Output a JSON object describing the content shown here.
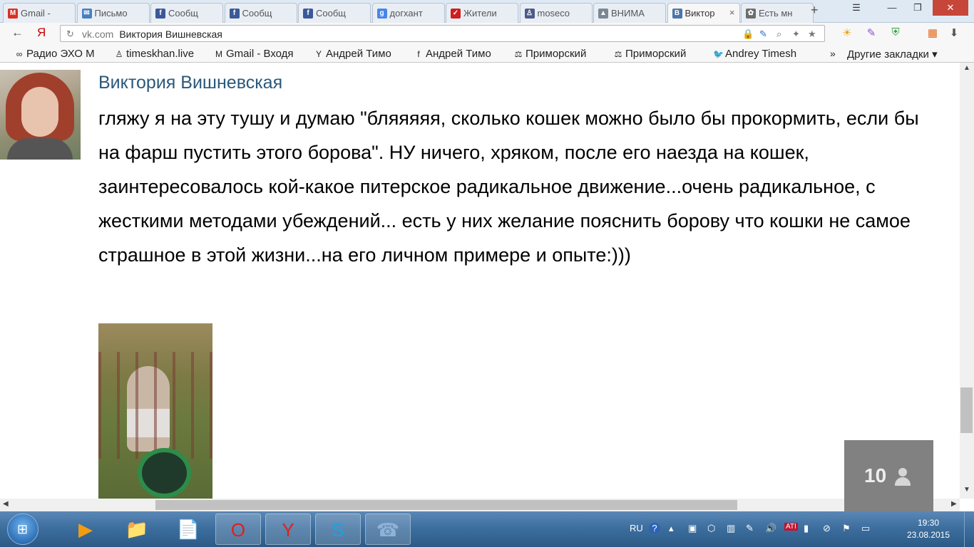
{
  "browser": {
    "tabs": [
      {
        "label": "Gmail -",
        "icon": "gmail-icon",
        "color": "#d93025",
        "glyph": "M"
      },
      {
        "label": "Письмо",
        "icon": "mail-icon",
        "color": "#4a7fbf",
        "glyph": "✉"
      },
      {
        "label": "Сообщ",
        "icon": "facebook-icon",
        "color": "#3b5998",
        "glyph": "f"
      },
      {
        "label": "Сообщ",
        "icon": "facebook-icon",
        "color": "#3b5998",
        "glyph": "f"
      },
      {
        "label": "Сообщ",
        "icon": "facebook-icon",
        "color": "#3b5998",
        "glyph": "f"
      },
      {
        "label": "догхант",
        "icon": "google-plus-icon",
        "color": "#4a86e8",
        "glyph": "g"
      },
      {
        "label": "Жители",
        "icon": "check-icon",
        "color": "#cc1f1f",
        "glyph": "✓"
      },
      {
        "label": "moseco",
        "icon": "user-icon",
        "color": "#4b5b8a",
        "glyph": "♙"
      },
      {
        "label": "ВНИМА",
        "icon": "page-icon",
        "color": "#7b8794",
        "glyph": "▲"
      },
      {
        "label": "Виктор",
        "icon": "vk-icon",
        "color": "#4a76a8",
        "glyph": "B",
        "active": true
      },
      {
        "label": "Есть мн",
        "icon": "paw-icon",
        "color": "#6d6d6d",
        "glyph": "✿"
      }
    ],
    "tab_close": "×",
    "new_tab": "+",
    "window_buttons": {
      "menu": "☰",
      "minimize": "—",
      "maximize": "❐",
      "close": "✕"
    },
    "nav": {
      "back": "←",
      "yandex": "Я"
    },
    "address": {
      "reload": "↻",
      "host": "vk.com",
      "title": "Виктория Вишневская"
    },
    "address_icons": [
      "🔒",
      "✎",
      "⌕",
      "✦",
      "★"
    ],
    "extensions": [
      "☀",
      "✎",
      "⛨",
      "▦",
      "⬇",
      "≡"
    ],
    "bookmarks": [
      {
        "label": "Радио ЭХО М",
        "glyph": "∞"
      },
      {
        "label": "timeskhan.live",
        "glyph": "♙"
      },
      {
        "label": "Gmail - Входя",
        "glyph": "M"
      },
      {
        "label": "Андрей Тимо",
        "glyph": "Y"
      },
      {
        "label": "Андрей Тимо",
        "glyph": "f"
      },
      {
        "label": "Приморский",
        "glyph": "⚖"
      },
      {
        "label": "Приморский",
        "glyph": "⚖"
      },
      {
        "label": "Andrey Timesh",
        "glyph": "🐦"
      }
    ],
    "bookmarks_more": "»",
    "other_bookmarks": "Другие закладки ▾"
  },
  "post": {
    "author": "Виктория Вишневская",
    "text": "гляжу я на эту тушу и думаю \"бляяяяя, сколько кошек можно было бы прокормить, если бы на фарш пустить этого борова\". НУ ничего, хряком, после его наезда на кошек, заинтересовалось кой-какое питерское радикальное движение...очень радикальное, с жесткими методами убеждений... есть у них желание пояснить борову что кошки не самое страшное в этой жизни...на его личном примере и опыте:)))"
  },
  "online_widget": {
    "count": "10"
  },
  "scroll": {
    "vertical_up": "▲",
    "vertical_down": "▼",
    "horizontal_left": "◀",
    "horizontal_right": "▶"
  },
  "taskbar": {
    "start": "⊞",
    "apps": [
      {
        "name": "media-player-icon",
        "glyph": "▶"
      },
      {
        "name": "explorer-icon",
        "glyph": "📁"
      },
      {
        "name": "document-icon",
        "glyph": "📄"
      },
      {
        "name": "opera-icon",
        "glyph": "O"
      },
      {
        "name": "yandex-browser-icon",
        "glyph": "Y"
      },
      {
        "name": "skype-icon",
        "glyph": "S"
      },
      {
        "name": "phone-app-icon",
        "glyph": "☎"
      }
    ],
    "tray": {
      "lang": "RU",
      "help": "?",
      "icons": [
        "▴",
        "▣",
        "⬡",
        "▥",
        "✎",
        "🔊",
        "ATI",
        "▮",
        "⊘",
        "⚑",
        "▭"
      ]
    },
    "time": "19:30",
    "date": "23.08.2015"
  }
}
